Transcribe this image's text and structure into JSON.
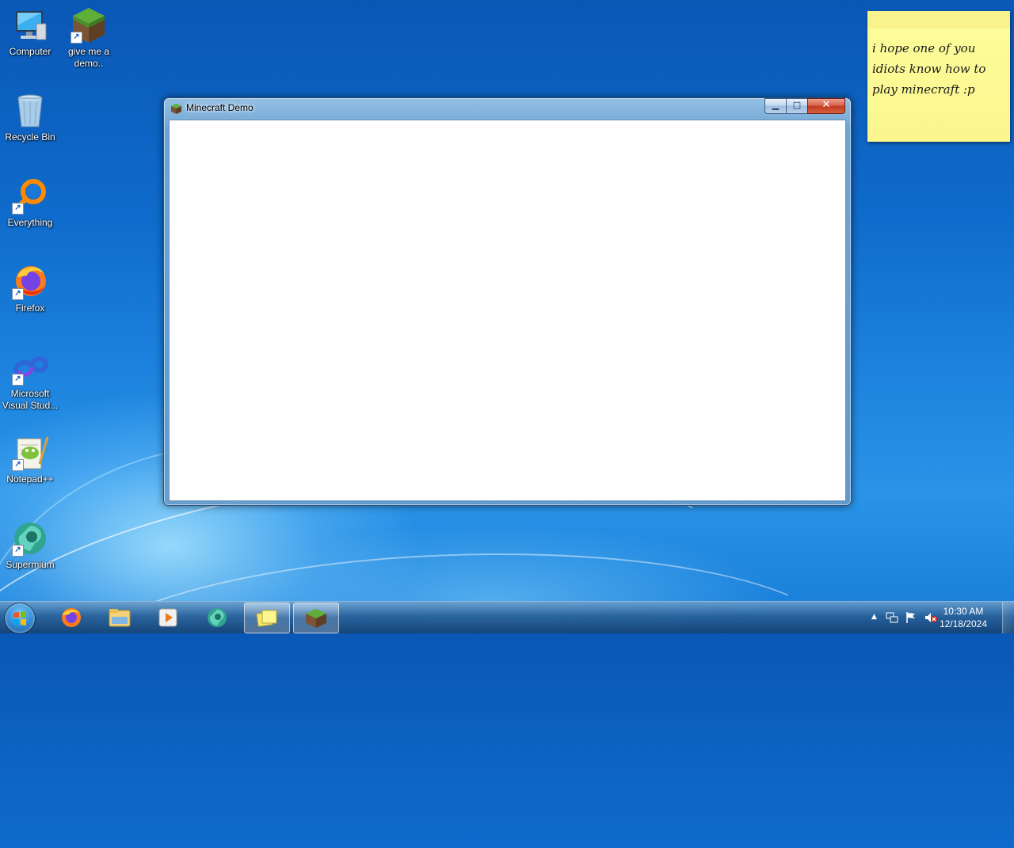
{
  "desktop": {
    "icons": [
      {
        "label": "Computer"
      },
      {
        "label": "give me a demo.."
      },
      {
        "label": "Recycle Bin"
      },
      {
        "label": "Everything"
      },
      {
        "label": "Firefox"
      },
      {
        "label": "Microsoft Visual Stud..."
      },
      {
        "label": "Notepad++"
      },
      {
        "label": "Supermium"
      }
    ]
  },
  "window": {
    "title": "Minecraft Demo",
    "icon": "minecraft-grass-block-icon",
    "min_glyph": "▁",
    "max_glyph": "□",
    "close_glyph": "✕"
  },
  "sticky_note": {
    "text": "i hope one of you idiots know how to play minecraft :p"
  },
  "taskbar": {
    "buttons": [
      {
        "icon": "firefox-icon"
      },
      {
        "icon": "file-explorer-icon"
      },
      {
        "icon": "media-player-icon"
      },
      {
        "icon": "supermium-icon"
      },
      {
        "icon": "sticky-notes-icon",
        "active": true
      },
      {
        "icon": "minecraft-icon",
        "active": true
      }
    ],
    "tray": {
      "expand_glyph": "▲",
      "time": "10:30 AM",
      "date": "12/18/2024"
    }
  },
  "colors": {
    "desktop_blue": "#0f6ccc",
    "sticky_yellow": "#fbf68e",
    "close_red": "#c03a22"
  }
}
